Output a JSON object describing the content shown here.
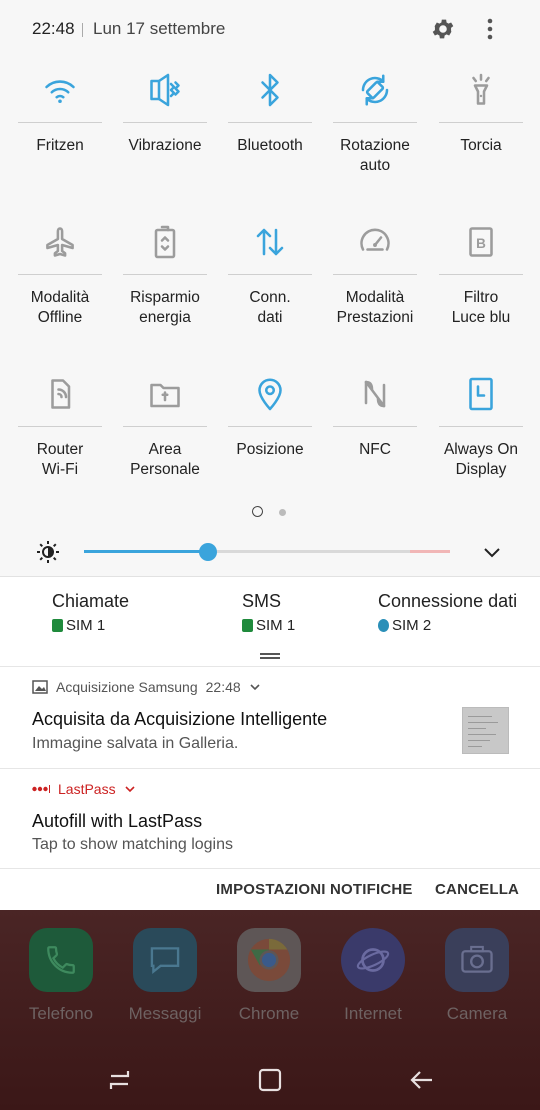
{
  "status": {
    "time": "22:48",
    "date": "Lun 17 settembre"
  },
  "tiles": [
    {
      "label": "Fritzen",
      "icon": "wifi-icon",
      "active": true
    },
    {
      "label": "Vibrazione",
      "icon": "vibrate-icon",
      "active": true
    },
    {
      "label": "Bluetooth",
      "icon": "bluetooth-icon",
      "active": true
    },
    {
      "label": "Rotazione\nauto",
      "icon": "rotation-icon",
      "active": true
    },
    {
      "label": "Torcia",
      "icon": "flashlight-icon",
      "active": false
    },
    {
      "label": "Modalità\nOffline",
      "icon": "airplane-icon",
      "active": false
    },
    {
      "label": "Risparmio\nenergia",
      "icon": "battery-saver-icon",
      "active": false
    },
    {
      "label": "Conn.\ndati",
      "icon": "data-arrows-icon",
      "active": true
    },
    {
      "label": "Modalità\nPrestazioni",
      "icon": "speedometer-icon",
      "active": false
    },
    {
      "label": "Filtro\nLuce blu",
      "icon": "blue-light-filter-icon",
      "active": false
    },
    {
      "label": "Router\nWi-Fi",
      "icon": "hotspot-icon",
      "active": false
    },
    {
      "label": "Area\nPersonale",
      "icon": "secure-folder-icon",
      "active": false
    },
    {
      "label": "Posizione",
      "icon": "location-pin-icon",
      "active": true
    },
    {
      "label": "NFC",
      "icon": "nfc-icon",
      "active": false
    },
    {
      "label": "Always On\nDisplay",
      "icon": "always-on-display-icon",
      "active": true
    }
  ],
  "brightness": {
    "level": 0.34
  },
  "sim": [
    {
      "title": "Chiamate",
      "sim": "SIM 1",
      "badge_color": "#1f8a3c"
    },
    {
      "title": "SMS",
      "sim": "SIM 1",
      "badge_color": "#1f8a3c"
    },
    {
      "title": "Connessione dati",
      "sim": "SIM 2",
      "badge_color": "#2a8fb8"
    }
  ],
  "notifications": [
    {
      "app": "Acquisizione Samsung",
      "time": "22:48",
      "title": "Acquisita da Acquisizione Intelligente",
      "text": "Immagine salvata in Galleria."
    },
    {
      "app": "LastPass",
      "title": "Autofill with LastPass",
      "text": "Tap to show matching logins"
    }
  ],
  "actions": {
    "settings": "IMPOSTAZIONI NOTIFICHE",
    "clear": "CANCELLA"
  },
  "dock": [
    {
      "label": "Telefono",
      "color": "#1e5a3a"
    },
    {
      "label": "Messaggi",
      "color": "#2a4a5a"
    },
    {
      "label": "Chrome",
      "color": "#5e5656"
    },
    {
      "label": "Internet",
      "color": "#3a3a6a"
    },
    {
      "label": "Camera",
      "color": "#3a3f5a"
    }
  ],
  "colors": {
    "accent": "#3aa4dc",
    "inactive": "#9c9c9c",
    "lastpass_red": "#cc2222"
  }
}
